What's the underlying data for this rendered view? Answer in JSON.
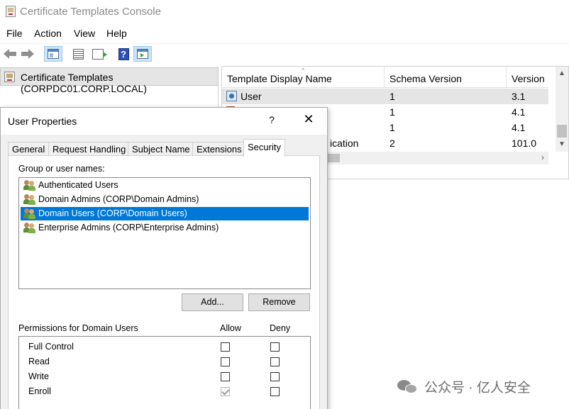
{
  "window": {
    "title": "Certificate Templates Console"
  },
  "menu": [
    "File",
    "Action",
    "View",
    "Help"
  ],
  "toolbar": {
    "icons": [
      "back-arrow-icon",
      "forward-arrow-icon",
      "show-hide-console-tree-icon",
      "properties-icon",
      "export-list-icon",
      "help-icon",
      "show-hide-action-pane-icon"
    ],
    "help_glyph": "?"
  },
  "tree": {
    "root_label": "Certificate Templates (CORPDC01.CORP.LOCAL)"
  },
  "list": {
    "columns": [
      "Template Display Name",
      "Schema Version",
      "Version"
    ],
    "rows": [
      {
        "name": "User",
        "schema": "1",
        "version": "3.1"
      },
      {
        "name": "",
        "schema": "1",
        "version": "4.1"
      },
      {
        "name": "",
        "schema": "1",
        "version": "4.1"
      },
      {
        "name": "ication",
        "schema": "2",
        "version": "101.0"
      }
    ]
  },
  "dialog": {
    "title": "User Properties",
    "help": "?",
    "close": "✕",
    "tabs": [
      "General",
      "Request Handling",
      "Subject Name",
      "Extensions",
      "Security"
    ],
    "active_tab": "Security",
    "group_label": "Group or user names:",
    "principals": [
      "Authenticated Users",
      "Domain Admins (CORP\\Domain Admins)",
      "Domain Users (CORP\\Domain Users)",
      "Enterprise Admins (CORP\\Enterprise Admins)"
    ],
    "selected_principal_index": 2,
    "add_button": "Add...",
    "remove_button": "Remove",
    "permissions_label": "Permissions for Domain Users",
    "allow_header": "Allow",
    "deny_header": "Deny",
    "permissions": [
      {
        "name": "Full Control",
        "allow": false,
        "deny": false
      },
      {
        "name": "Read",
        "allow": false,
        "deny": false
      },
      {
        "name": "Write",
        "allow": false,
        "deny": false
      },
      {
        "name": "Enroll",
        "allow": true,
        "deny": false
      }
    ]
  },
  "watermark": {
    "text": "公众号 · 亿人安全"
  },
  "colors": {
    "selection": "#0078d7",
    "tree_selection": "#e5e5e5",
    "dialog_bg": "#f0f0f0"
  }
}
